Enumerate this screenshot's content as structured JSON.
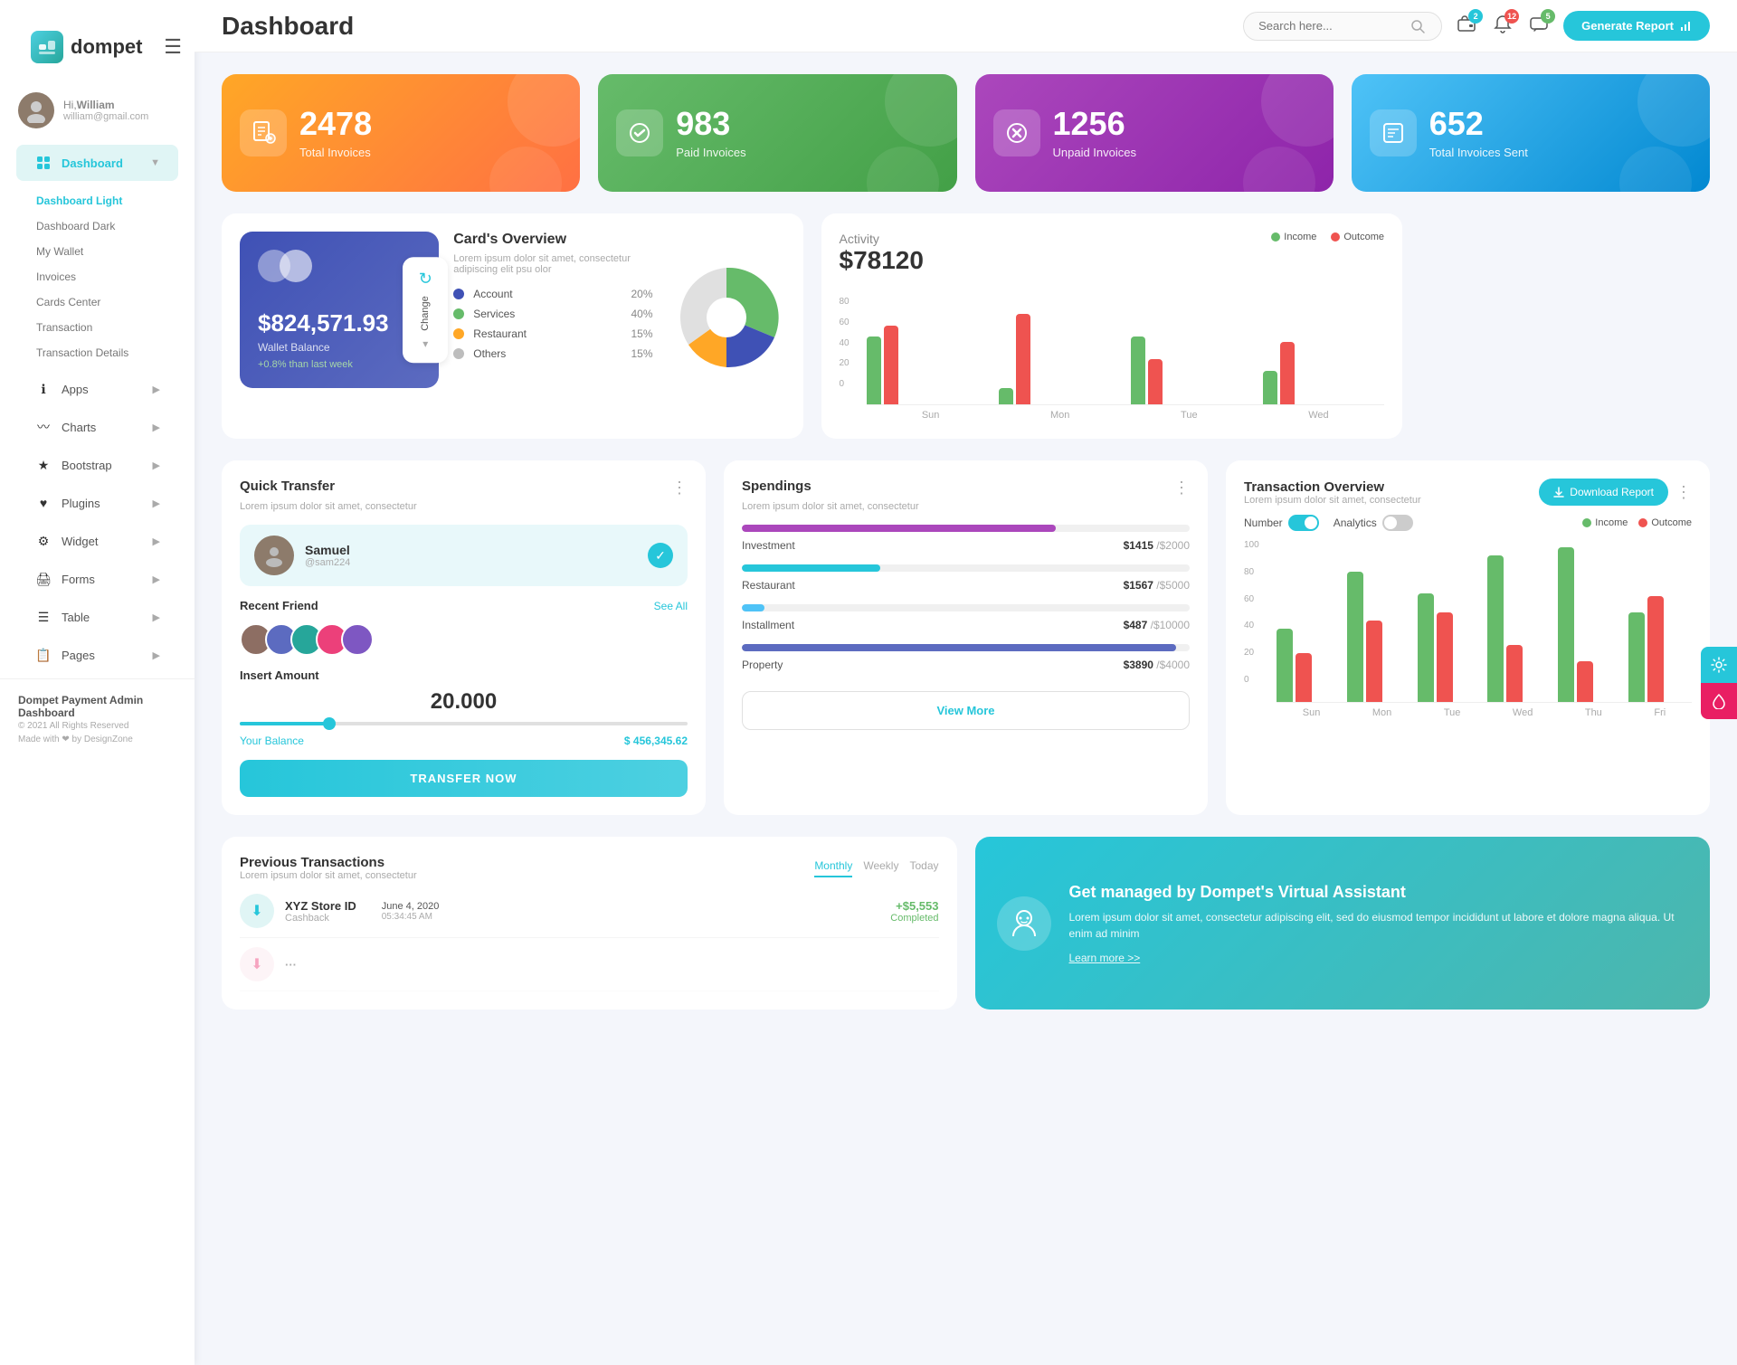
{
  "app": {
    "name": "dompet",
    "tagline": "Dompet Payment Admin Dashboard",
    "copyright": "© 2021 All Rights Reserved",
    "made_with": "Made with ❤ by DesignZone"
  },
  "header": {
    "title": "Dashboard",
    "search_placeholder": "Search here...",
    "generate_report": "Generate Report",
    "badges": {
      "wallet": "2",
      "bell": "12",
      "chat": "5"
    }
  },
  "user": {
    "greeting": "Hi,",
    "name": "William",
    "email": "william@gmail.com"
  },
  "sidebar": {
    "active": "Dashboard",
    "sub_items": [
      "Dashboard Light",
      "Dashboard Dark",
      "My Wallet",
      "Invoices",
      "Cards Center",
      "Transaction",
      "Transaction Details"
    ],
    "nav_items": [
      {
        "label": "Apps",
        "icon": "ℹ",
        "has_arrow": true
      },
      {
        "label": "Charts",
        "icon": "📈",
        "has_arrow": true
      },
      {
        "label": "Bootstrap",
        "icon": "★",
        "has_arrow": true
      },
      {
        "label": "Plugins",
        "icon": "♥",
        "has_arrow": true
      },
      {
        "label": "Widget",
        "icon": "⚙",
        "has_arrow": true
      },
      {
        "label": "Forms",
        "icon": "🖨",
        "has_arrow": true
      },
      {
        "label": "Table",
        "icon": "☰",
        "has_arrow": true
      },
      {
        "label": "Pages",
        "icon": "📋",
        "has_arrow": true
      }
    ]
  },
  "stats": [
    {
      "number": "2478",
      "label": "Total Invoices",
      "color": "orange",
      "icon": "📋"
    },
    {
      "number": "983",
      "label": "Paid Invoices",
      "color": "green",
      "icon": "✔"
    },
    {
      "number": "1256",
      "label": "Unpaid Invoices",
      "color": "purple",
      "icon": "✖"
    },
    {
      "number": "652",
      "label": "Total Invoices Sent",
      "color": "teal",
      "icon": "📄"
    }
  ],
  "card_overview": {
    "title": "Card's Overview",
    "description": "Lorem ipsum dolor sit amet, consectetur adipiscing elit psu olor",
    "wallet_amount": "$824,571.93",
    "wallet_label": "Wallet Balance",
    "wallet_change": "+0.8% than last week",
    "change_btn": "Change",
    "items": [
      {
        "name": "Account",
        "pct": "20%",
        "color": "#3f51b5"
      },
      {
        "name": "Services",
        "pct": "40%",
        "color": "#66bb6a"
      },
      {
        "name": "Restaurant",
        "pct": "15%",
        "color": "#ffa726"
      },
      {
        "name": "Others",
        "pct": "15%",
        "color": "#bdbdbd"
      }
    ]
  },
  "activity": {
    "title": "Activity",
    "amount": "$78120",
    "legend": {
      "income": "Income",
      "outcome": "Outcome"
    },
    "bars": [
      {
        "day": "Sun",
        "income": 50,
        "outcome": 70
      },
      {
        "day": "Mon",
        "income": 15,
        "outcome": 80
      },
      {
        "day": "Tue",
        "income": 60,
        "outcome": 40
      },
      {
        "day": "Wed",
        "income": 30,
        "outcome": 55
      }
    ]
  },
  "quick_transfer": {
    "title": "Quick Transfer",
    "description": "Lorem ipsum dolor sit amet, consectetur",
    "person": {
      "name": "Samuel",
      "handle": "@sam224"
    },
    "recent_friend_label": "Recent Friend",
    "see_all": "See All",
    "insert_amount_label": "Insert Amount",
    "amount": "20.000",
    "your_balance_label": "Your Balance",
    "your_balance": "$ 456,345.62",
    "transfer_btn": "TRANSFER NOW"
  },
  "spendings": {
    "title": "Spendings",
    "description": "Lorem ipsum dolor sit amet, consectetur",
    "items": [
      {
        "name": "Investment",
        "current": "$1415",
        "max": "$2000",
        "color": "#ab47bc",
        "pct": 70
      },
      {
        "name": "Restaurant",
        "current": "$1567",
        "max": "$5000",
        "color": "#26c6da",
        "pct": 31
      },
      {
        "name": "Installment",
        "current": "$487",
        "max": "$10000",
        "color": "#4fc3f7",
        "pct": 5
      },
      {
        "name": "Property",
        "current": "$3890",
        "max": "$4000",
        "color": "#5c6bc0",
        "pct": 97
      }
    ],
    "view_more": "View More"
  },
  "transaction_overview": {
    "title": "Transaction Overview",
    "description": "Lorem ipsum dolor sit amet, consectetur",
    "download_btn": "Download Report",
    "toggles": [
      {
        "label": "Number",
        "on": true
      },
      {
        "label": "Analytics",
        "on": false
      }
    ],
    "legend": {
      "income": "Income",
      "outcome": "Outcome"
    },
    "bars": [
      {
        "day": "Sun",
        "income": 45,
        "outcome": 30
      },
      {
        "day": "Mon",
        "income": 80,
        "outcome": 50
      },
      {
        "day": "Tue",
        "income": 67,
        "outcome": 55
      },
      {
        "day": "Wed",
        "income": 90,
        "outcome": 35
      },
      {
        "day": "Thu",
        "income": 95,
        "outcome": 25
      },
      {
        "day": "Fri",
        "income": 55,
        "outcome": 65
      }
    ],
    "y_labels": [
      "100",
      "80",
      "60",
      "40",
      "20",
      "0"
    ]
  },
  "previous_transactions": {
    "title": "Previous Transactions",
    "description": "Lorem ipsum dolor sit amet, consectetur",
    "tabs": [
      "Monthly",
      "Weekly",
      "Today"
    ],
    "active_tab": "Monthly",
    "items": [
      {
        "icon": "⬇",
        "name": "XYZ Store ID",
        "sub": "Cashback",
        "date": "June 4, 2020",
        "time": "05:34:45 AM",
        "amount": "+$5,553",
        "status": "Completed",
        "icon_bg": "#e0f5f5"
      }
    ]
  },
  "virtual_assistant": {
    "title": "Get managed by Dompet's Virtual Assistant",
    "description": "Lorem ipsum dolor sit amet, consectetur adipiscing elit, sed do eiusmod tempor incididunt ut labore et dolore magna aliqua. Ut enim ad minim",
    "link": "Learn more >>"
  }
}
